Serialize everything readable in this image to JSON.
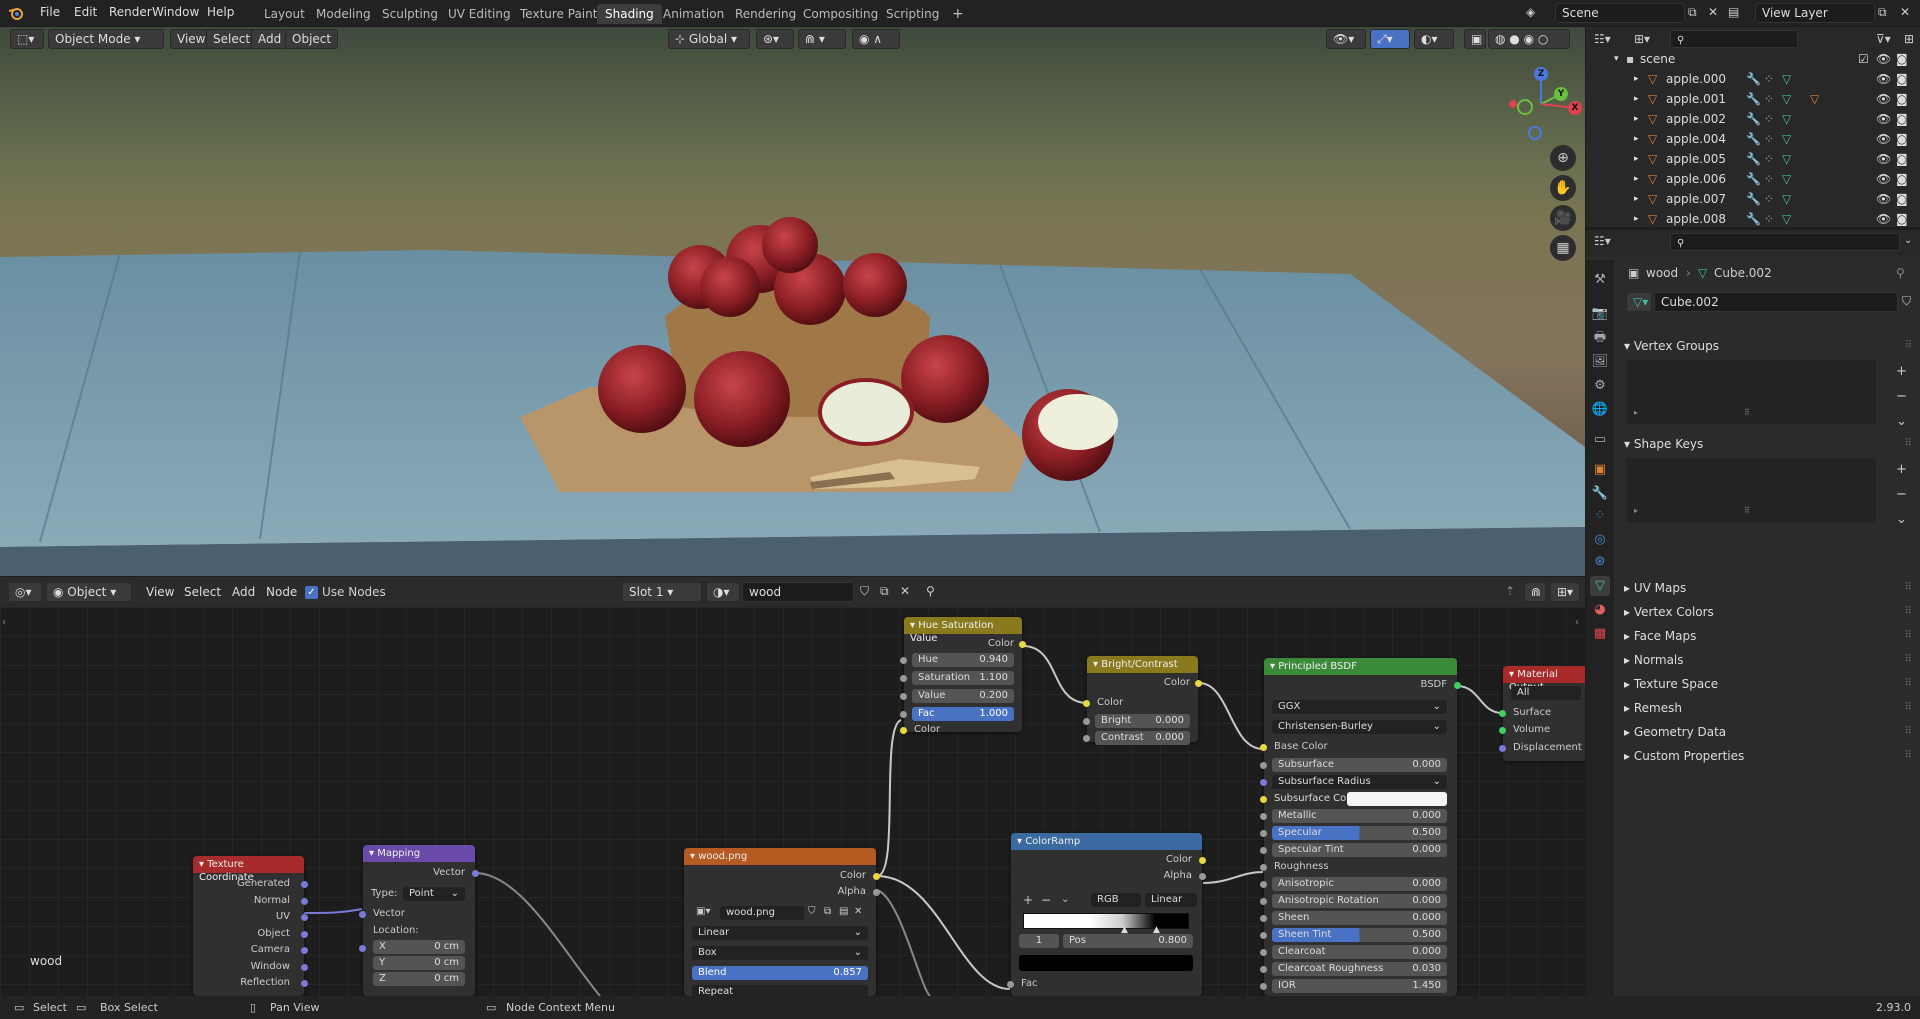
{
  "topbar": {
    "menus": [
      "File",
      "Edit",
      "Render",
      "Window",
      "Help"
    ],
    "workspaces": [
      "Layout",
      "Modeling",
      "Sculpting",
      "UV Editing",
      "Texture Paint",
      "Shading",
      "Animation",
      "Rendering",
      "Compositing",
      "Scripting"
    ],
    "active_workspace": "Shading",
    "add_tab_icon": "+",
    "scene": "Scene",
    "view_layer": "View Layer"
  },
  "viewport_header": {
    "mode": "Object Mode",
    "menus": [
      "View",
      "Select",
      "Add",
      "Object"
    ],
    "transform": "Global"
  },
  "gizmo": {
    "x": "X",
    "y": "Y",
    "z": "Z"
  },
  "node_header": {
    "type": "Object",
    "menus": [
      "View",
      "Select",
      "Add",
      "Node"
    ],
    "use_nodes": "Use Nodes",
    "slot": "Slot 1",
    "material": "wood"
  },
  "nodes": {
    "hsv": {
      "title": "Hue Saturation Value",
      "out_color": "Color",
      "hue_label": "Hue",
      "hue": "0.940",
      "sat_label": "Saturation",
      "sat": "1.100",
      "val_label": "Value",
      "val": "0.200",
      "fac_label": "Fac",
      "fac": "1.000",
      "in_color": "Color"
    },
    "bc": {
      "title": "Bright/Contrast",
      "out_color": "Color",
      "in_color": "Color",
      "bright_label": "Bright",
      "bright": "0.000",
      "contrast_label": "Contrast",
      "contrast": "0.000"
    },
    "bsdf": {
      "title": "Principled BSDF",
      "out": "BSDF",
      "dist": "GGX",
      "sss_method": "Christensen-Burley",
      "base_color": "Base Color",
      "rows": [
        {
          "label": "Subsurface",
          "value": "0.000"
        },
        {
          "label": "Subsurface Radius",
          "value": ""
        },
        {
          "label": "Subsurface Colo",
          "value": ""
        },
        {
          "label": "Metallic",
          "value": "0.000"
        },
        {
          "label": "Specular",
          "value": "0.500"
        },
        {
          "label": "Specular Tint",
          "value": "0.000"
        },
        {
          "label": "Roughness",
          "value": ""
        },
        {
          "label": "Anisotropic",
          "value": "0.000"
        },
        {
          "label": "Anisotropic Rotation",
          "value": "0.000"
        },
        {
          "label": "Sheen",
          "value": "0.000"
        },
        {
          "label": "Sheen Tint",
          "value": "0.500"
        },
        {
          "label": "Clearcoat",
          "value": "0.000"
        },
        {
          "label": "Clearcoat Roughness",
          "value": "0.030"
        },
        {
          "label": "IOR",
          "value": "1.450"
        }
      ]
    },
    "matout": {
      "title": "Material Output",
      "target": "All",
      "surface": "Surface",
      "volume": "Volume",
      "displacement": "Displacement"
    },
    "colorramp": {
      "title": "ColorRamp",
      "out_color": "Color",
      "out_alpha": "Alpha",
      "mode": "RGB",
      "interp": "Linear",
      "index": "1",
      "pos_label": "Pos",
      "pos": "0.800",
      "fac": "Fac",
      "add": "+",
      "remove": "−"
    },
    "image": {
      "title": "wood.png",
      "out_color": "Color",
      "out_alpha": "Alpha",
      "file": "wood.png",
      "interp": "Linear",
      "proj": "Box",
      "blend_label": "Blend",
      "blend": "0.857",
      "extra": "Repeat"
    },
    "mapping": {
      "title": "Mapping",
      "out": "Vector",
      "type_label": "Type:",
      "type": "Point",
      "in_vector": "Vector",
      "location": "Location:",
      "x_label": "X",
      "x": "0 cm",
      "y_label": "Y",
      "y": "0 cm",
      "z_label": "Z",
      "z": "0 cm"
    },
    "texcoord": {
      "title": "Texture Coordinate",
      "outputs": [
        "Generated",
        "Normal",
        "UV",
        "Object",
        "Camera",
        "Window",
        "Reflection"
      ]
    }
  },
  "node_editor_label": "wood",
  "outliner": {
    "root": "scene",
    "items": [
      "apple.000",
      "apple.001",
      "apple.002",
      "apple.004",
      "apple.005",
      "apple.006",
      "apple.007",
      "apple.008"
    ]
  },
  "properties": {
    "breadcrumb_object": "wood",
    "breadcrumb_mesh": "Cube.002",
    "mesh_name": "Cube.002",
    "sections_open": [
      "Vertex Groups",
      "Shape Keys"
    ],
    "sections_closed": [
      "UV Maps",
      "Vertex Colors",
      "Face Maps",
      "Normals",
      "Texture Space",
      "Remesh",
      "Geometry Data",
      "Custom Properties"
    ]
  },
  "statusbar": {
    "select": "Select",
    "box_select": "Box Select",
    "pan": "Pan View",
    "context": "Node Context Menu",
    "version": "2.93.0"
  },
  "colors": {
    "accent": "#4a72c4",
    "hsv_header": "#8a7a1e",
    "bc_header": "#8a7a1e",
    "bsdf_header": "#3a8a3a",
    "matout_header": "#a82a2a",
    "colorramp_header": "#3a6aa0",
    "image_header": "#b55a20",
    "mapping_header": "#6a4aa8",
    "texcoord_header": "#a82a2a",
    "apple_icon": "#e08030",
    "mesh_icon": "#40c0a0"
  }
}
